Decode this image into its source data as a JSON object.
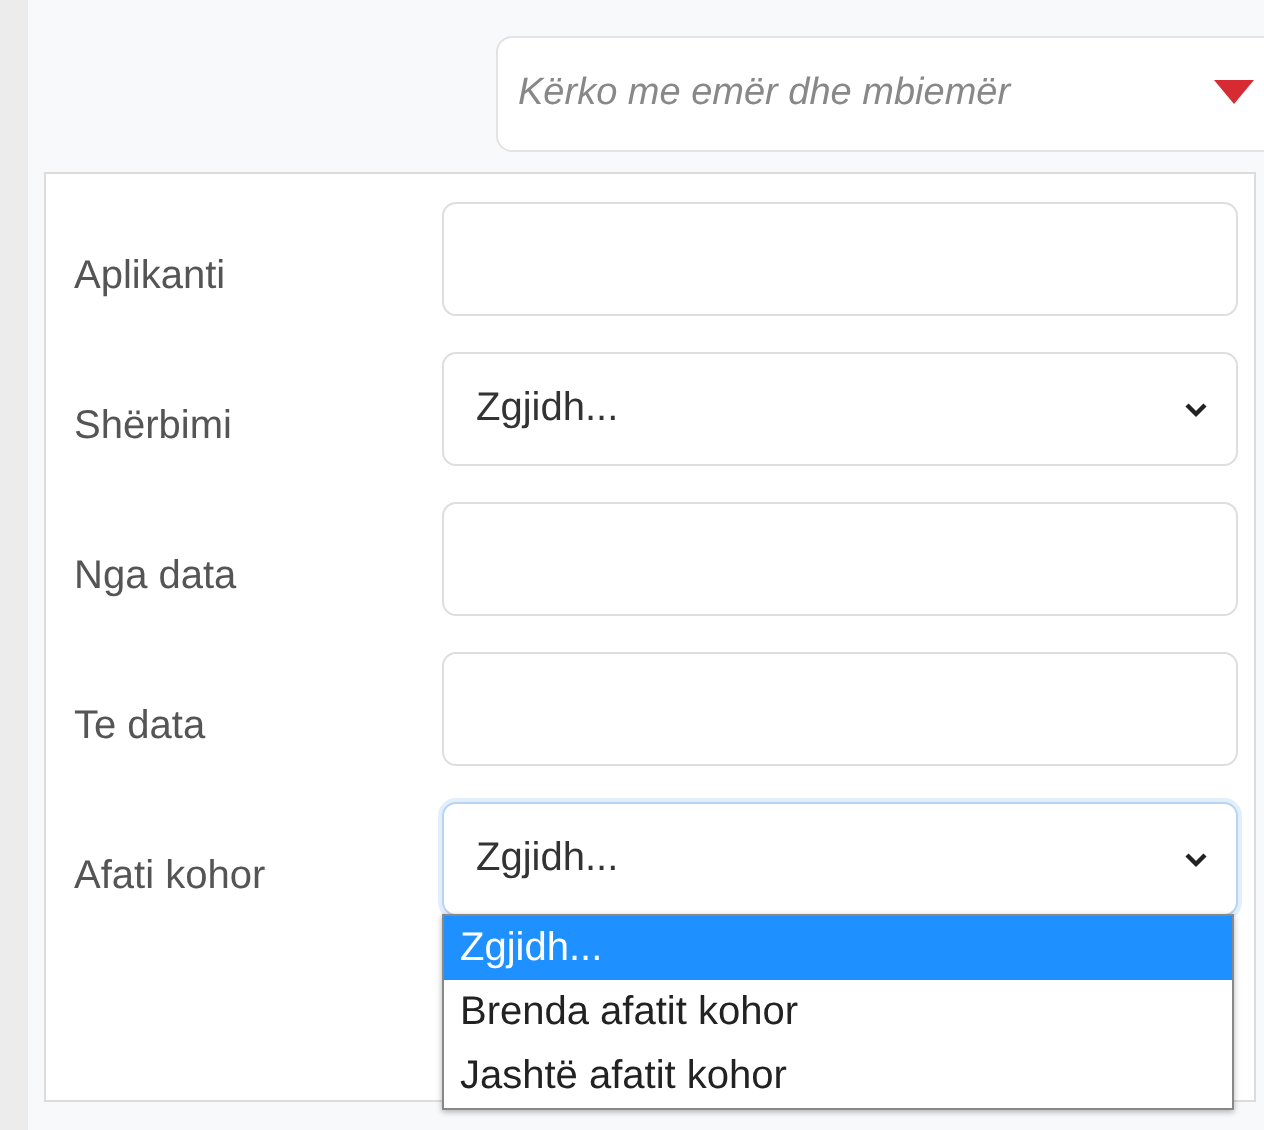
{
  "search": {
    "placeholder": "Kërko me emër dhe mbiemër"
  },
  "filters": [
    {
      "label": "Aplikanti",
      "kind": "input"
    },
    {
      "label": "Shërbimi",
      "kind": "select",
      "value": "Zgjidh..."
    },
    {
      "label": "Nga data",
      "kind": "input"
    },
    {
      "label": "Te data",
      "kind": "input"
    },
    {
      "label": "Afati kohor",
      "kind": "select",
      "value": "Zgjidh...",
      "expanded": true,
      "options": [
        {
          "label": "Zgjidh...",
          "selected": true
        },
        {
          "label": "Brenda afatit kohor",
          "selected": false
        },
        {
          "label": "Jashtë afatit kohor",
          "selected": false
        }
      ]
    }
  ]
}
